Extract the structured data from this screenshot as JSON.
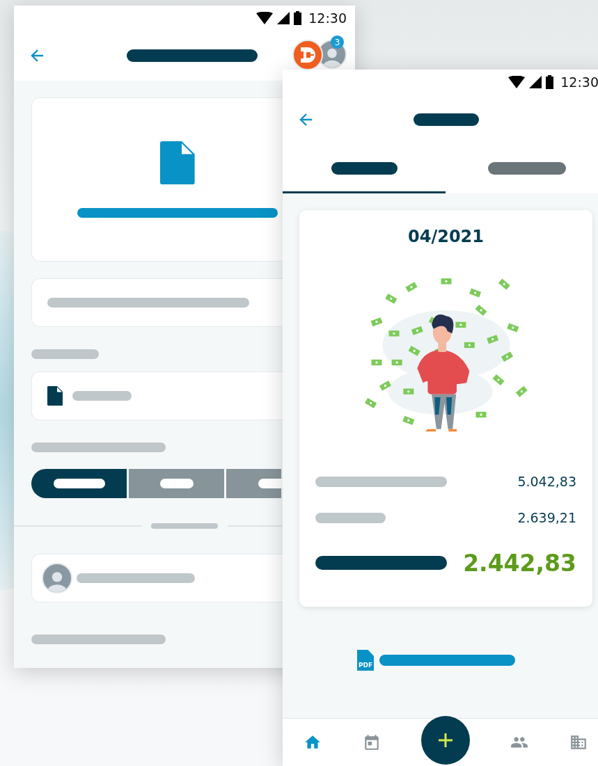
{
  "back_screen": {
    "status_bar": {
      "time": "12:30"
    },
    "header": {
      "badge": "3"
    },
    "segments": [
      {
        "selected": true
      },
      {
        "selected": false
      },
      {
        "selected": false
      }
    ]
  },
  "front_screen": {
    "status_bar": {
      "time": "12:30"
    },
    "tabs": [
      {
        "selected": true
      },
      {
        "selected": false
      }
    ],
    "card": {
      "period": "04/2021",
      "rows": [
        {
          "kind": "normal",
          "amount": "5.042,83"
        },
        {
          "kind": "normal",
          "amount": "2.639,21"
        },
        {
          "kind": "total",
          "amount": "2.442,83"
        }
      ]
    },
    "pdf_link": {
      "icon_text": "PDF"
    },
    "nav": [
      {
        "kind": "home",
        "selected": true
      },
      {
        "kind": "calendar",
        "selected": false
      },
      {
        "kind": "add"
      },
      {
        "kind": "people",
        "selected": false
      },
      {
        "kind": "building",
        "selected": false
      }
    ]
  }
}
